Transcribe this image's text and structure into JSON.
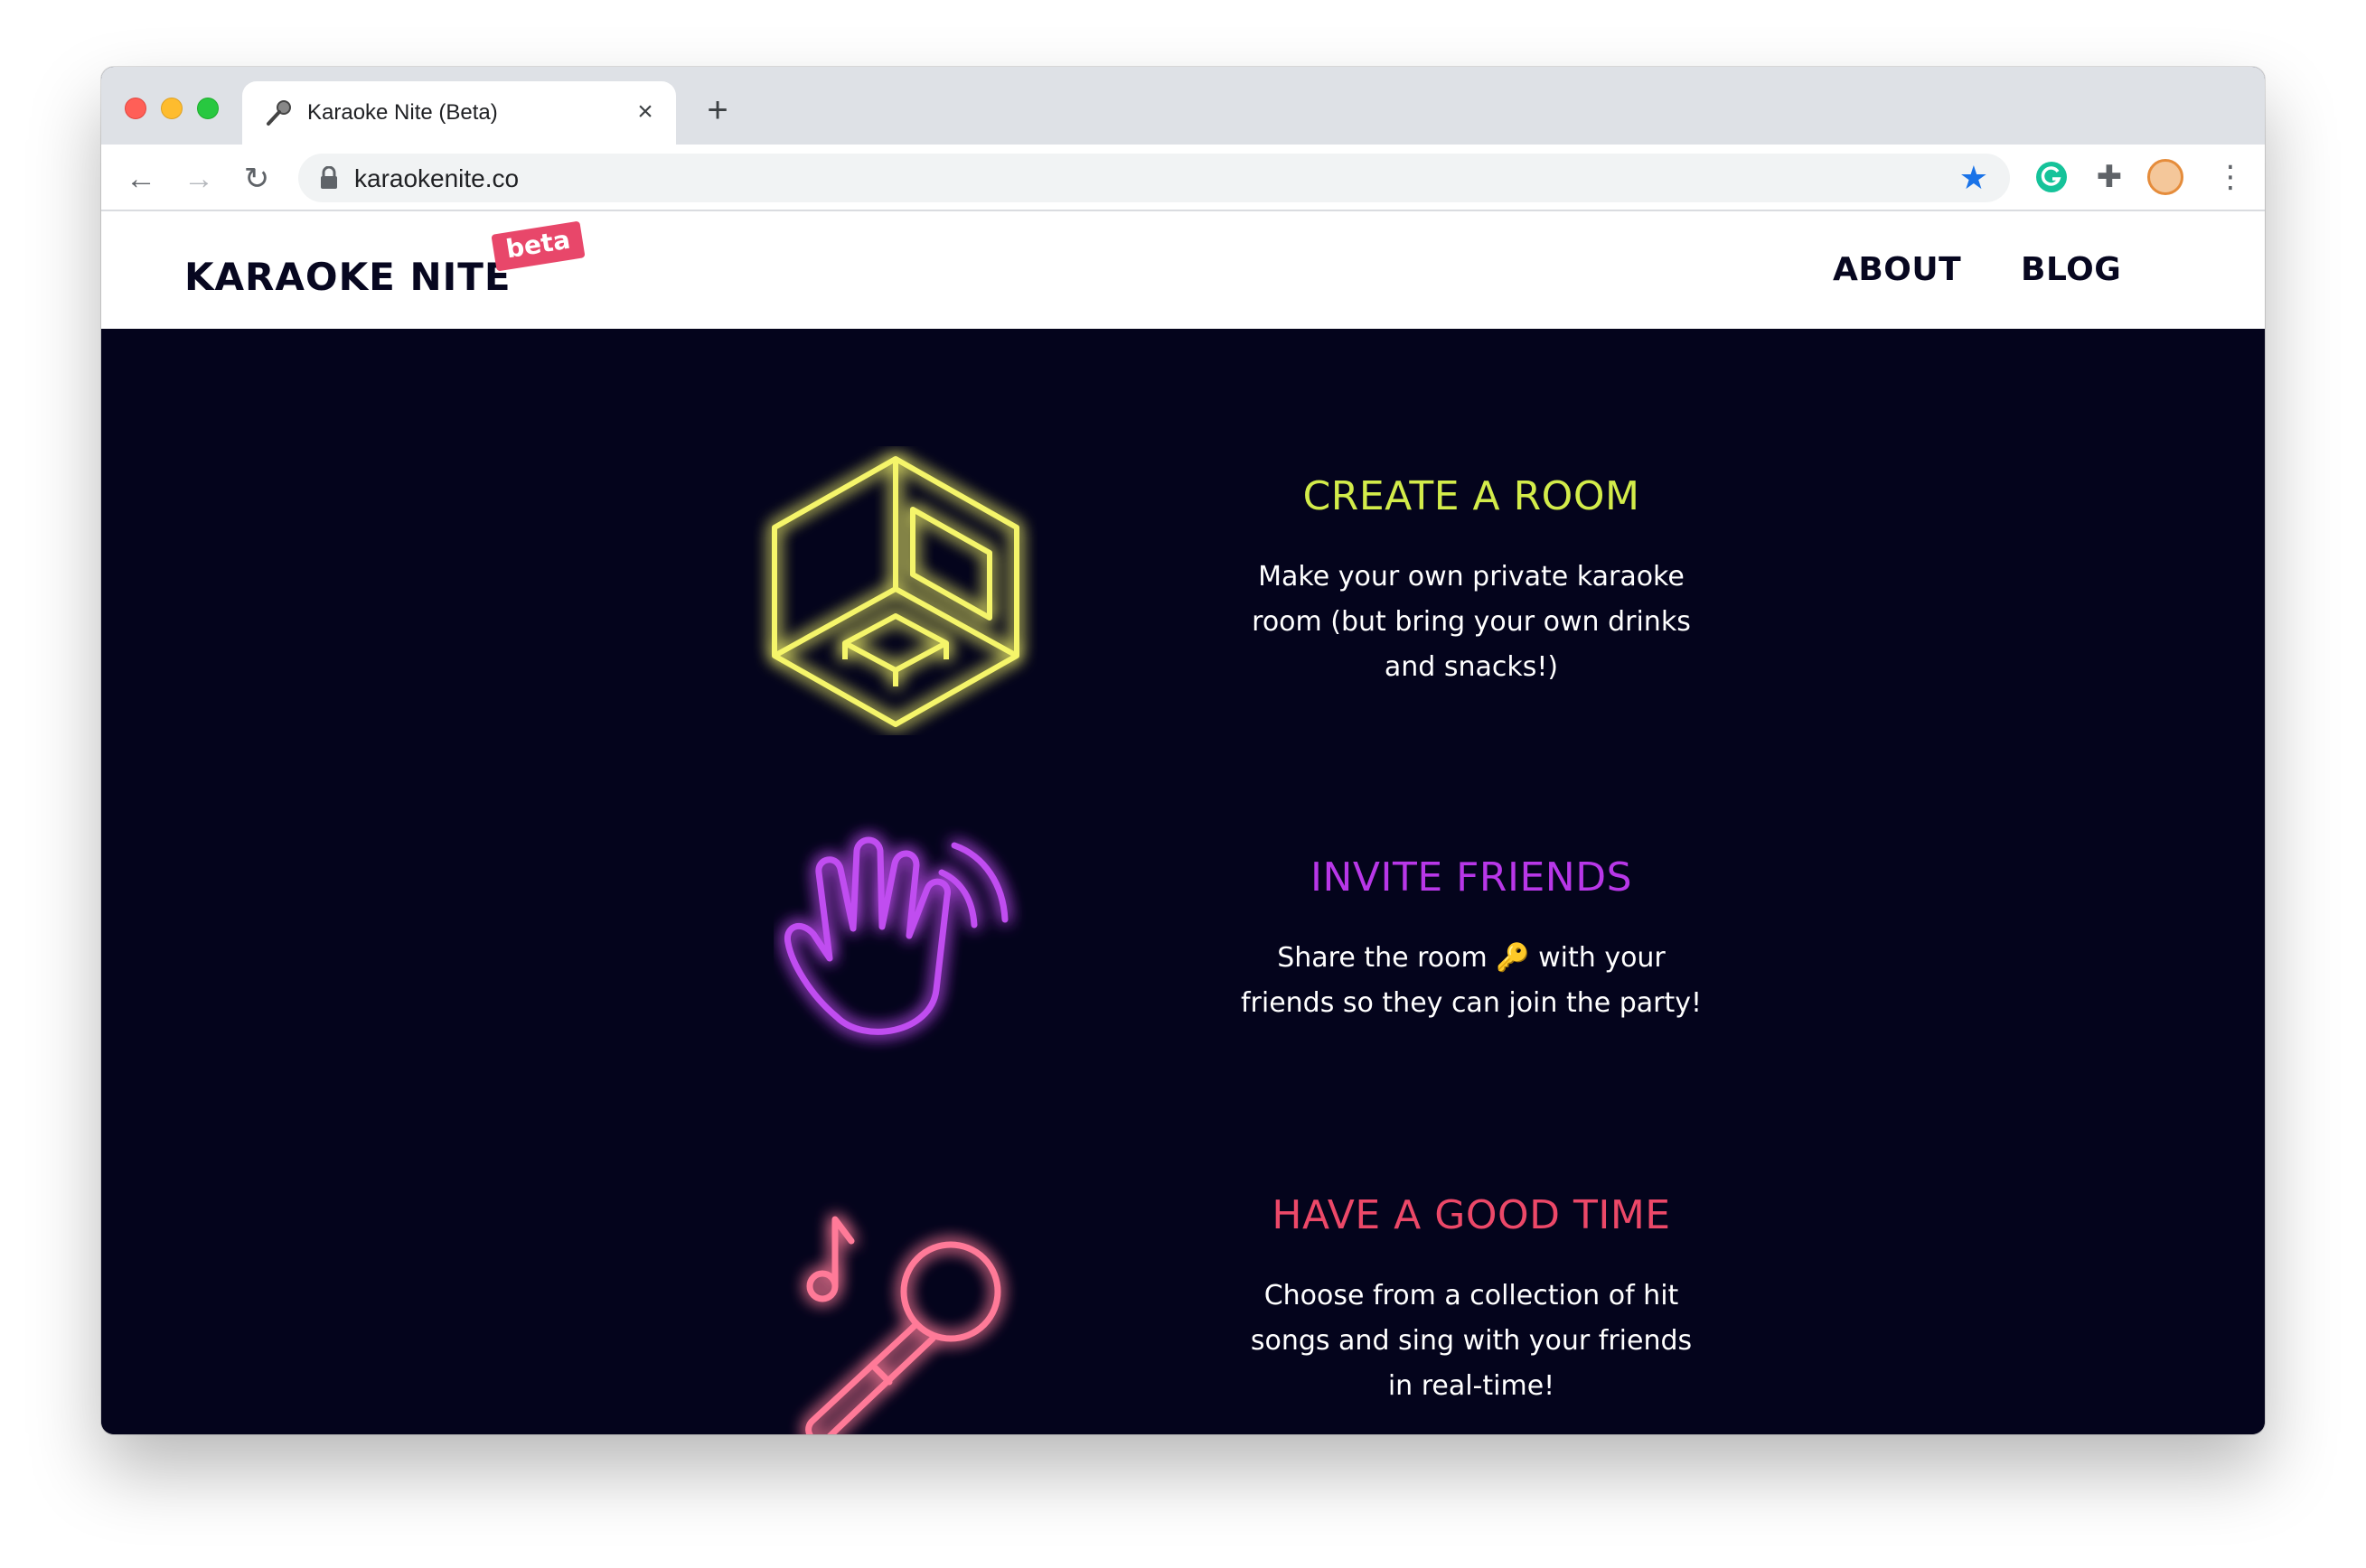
{
  "browser": {
    "tab": {
      "title": "Karaoke Nite (Beta)",
      "icon": "microphone-icon"
    },
    "url": "karaokenite.co",
    "icons": {
      "back": "arrow-left-icon",
      "forward": "arrow-right-icon",
      "reload": "reload-icon",
      "lock": "lock-icon",
      "bookmark": "star-icon",
      "grammarly": "grammarly-icon",
      "extensions": "puzzle-icon",
      "profile": "avatar-icon",
      "menu": "kebab-icon"
    }
  },
  "site": {
    "logo": "KARAOKE NITE",
    "badge": "beta",
    "nav": [
      "ABOUT",
      "BLOG"
    ]
  },
  "features": [
    {
      "title": "CREATE A ROOM",
      "lines": [
        "Make your own private karaoke",
        "room (but bring your own drinks",
        "and snacks!)"
      ],
      "color": "#d3ec4a",
      "icon": "room-cube-icon"
    },
    {
      "title": "INVITE FRIENDS",
      "lines": [
        "Share the room 🔑 with your",
        "friends so they can join the party!"
      ],
      "color": "#b837e8",
      "icon": "waving-hand-icon"
    },
    {
      "title": "HAVE A GOOD TIME",
      "lines": [
        "Choose from a collection of hit",
        "songs and sing with your friends",
        "in real-time!"
      ],
      "color": "#ec4868",
      "icon": "microphone-music-icon"
    }
  ]
}
